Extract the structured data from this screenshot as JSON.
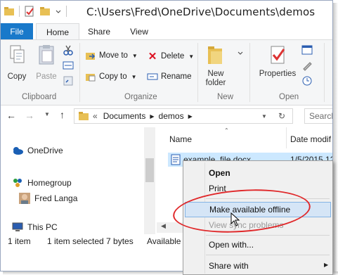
{
  "window": {
    "title": "C:\\Users\\Fred\\OneDrive\\Documents\\demos"
  },
  "ribbon_tabs": [
    "File",
    "Home",
    "Share",
    "View"
  ],
  "ribbon": {
    "clipboard": {
      "copy": "Copy",
      "paste": "Paste",
      "label": "Clipboard"
    },
    "organize": {
      "move_to": "Move to",
      "copy_to": "Copy to",
      "delete": "Delete",
      "rename": "Rename",
      "label": "Organize"
    },
    "new": {
      "new_folder_line1": "New",
      "new_folder_line2": "folder",
      "label": "New"
    },
    "open": {
      "properties": "Properties",
      "label": "Open"
    }
  },
  "address": {
    "prefix": "«",
    "crumbs": [
      "Documents",
      "demos"
    ],
    "search_placeholder": "Search"
  },
  "nav_pane": {
    "items": [
      "OneDrive",
      "Homegroup",
      "Fred Langa",
      "This PC"
    ]
  },
  "content": {
    "columns": [
      "Name",
      "Date modif"
    ],
    "files": [
      {
        "name": "example_file.docx",
        "date": "1/5/2015 12"
      }
    ]
  },
  "status": {
    "count": "1 item",
    "selected": "1 item selected  7 bytes",
    "available": "Available o"
  },
  "context_menu": {
    "items": [
      "Open",
      "Print",
      "Make available offline",
      "View sync problems",
      "Open with...",
      "Share with"
    ]
  },
  "colors": {
    "file_tab": "#1979ca",
    "highlight": "#d5e5f6",
    "annotation": "#e0282a"
  }
}
